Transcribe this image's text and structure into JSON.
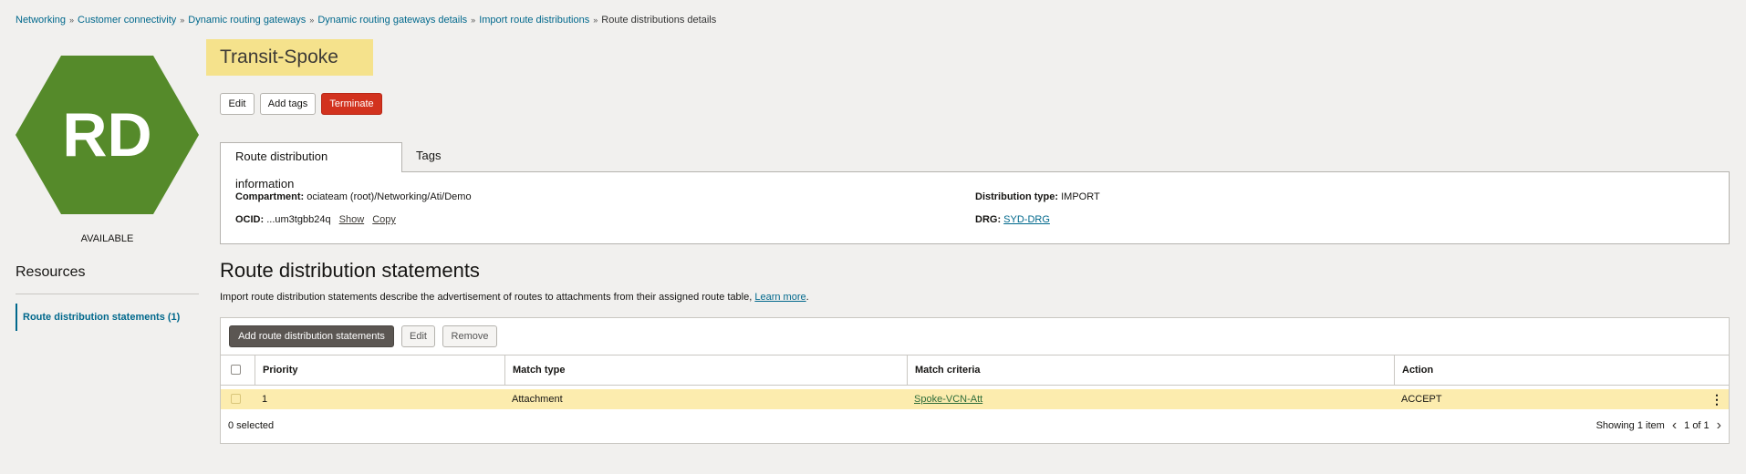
{
  "breadcrumb": {
    "items": [
      "Networking",
      "Customer connectivity",
      "Dynamic routing gateways",
      "Dynamic routing gateways details",
      "Import route distributions"
    ],
    "current": "Route distributions details",
    "separator": "»"
  },
  "resource": {
    "initials": "RD",
    "state": "AVAILABLE",
    "title": "Transit-Spoke",
    "hex_color": "#558a2a"
  },
  "actions": {
    "edit": "Edit",
    "add_tags": "Add tags",
    "terminate": "Terminate"
  },
  "tabs": {
    "info": "Route distribution information",
    "tags": "Tags"
  },
  "info": {
    "compartment_label": "Compartment:",
    "compartment_value": "ociateam (root)/Networking/Ati/Demo",
    "ocid_label": "OCID:",
    "ocid_value": "...um3tgbb24q",
    "show": "Show",
    "copy": "Copy",
    "distribution_type_label": "Distribution type:",
    "distribution_type_value": "IMPORT",
    "drg_label": "DRG:",
    "drg_value": "SYD-DRG"
  },
  "sidebar": {
    "title": "Resources",
    "items": [
      {
        "label": "Route distribution statements (1)"
      }
    ]
  },
  "statements": {
    "title": "Route distribution statements",
    "description": "Import route distribution statements describe the advertisement of routes to attachments from their assigned route table,",
    "learn_more": "Learn more",
    "learn_more_suffix": ".",
    "add_button": "Add route distribution statements",
    "edit_button": "Edit",
    "remove_button": "Remove",
    "columns": [
      "Priority",
      "Match type",
      "Match criteria",
      "Action"
    ],
    "rows": [
      {
        "priority": "1",
        "match_type": "Attachment",
        "match_criteria": "Spoke-VCN-Att",
        "action": "ACCEPT"
      }
    ],
    "selected_count": "0 selected",
    "showing": "Showing 1 item",
    "pages": "1 of 1"
  }
}
